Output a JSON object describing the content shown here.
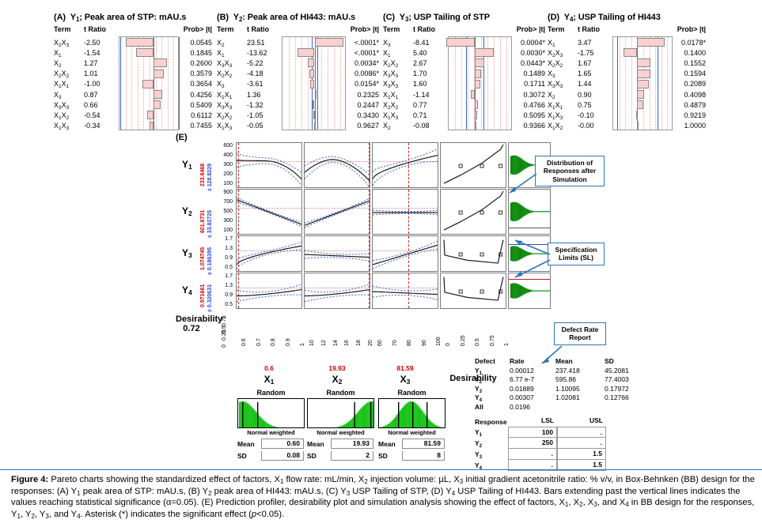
{
  "panels": [
    {
      "id": "A",
      "tag": "(A)",
      "title_prefix": "Y",
      "title_sub": "1",
      "title_rest": "; Peak area of STP: mAU.s",
      "col_term": "Term",
      "col_tratio": "t Ratio",
      "col_prob": "Prob> |t|",
      "rows": [
        {
          "term": "X2X3",
          "t": "-2.50",
          "p": "0.0545"
        },
        {
          "term": "X1",
          "t": "-1.54",
          "p": "0.1845"
        },
        {
          "term": "X2",
          "t": "1.27",
          "p": "0.2600"
        },
        {
          "term": "X2X2",
          "t": "1.01",
          "p": "0.3579"
        },
        {
          "term": "X1X1",
          "t": "-1.00",
          "p": "0.3654"
        },
        {
          "term": "X3",
          "t": "0.87",
          "p": "0.4256"
        },
        {
          "term": "X3X3",
          "t": "0.66",
          "p": "0.5409"
        },
        {
          "term": "X1X2",
          "t": "-0.54",
          "p": "0.6112"
        },
        {
          "term": "X1X3",
          "t": "-0.34",
          "p": "0.7455"
        }
      ]
    },
    {
      "id": "B",
      "tag": "(B)",
      "title_prefix": "Y",
      "title_sub": "2",
      "title_rest": ": Peak area of HI443: mAU.s",
      "col_term": "Term",
      "col_tratio": "t Ratio",
      "col_prob": "Prob> |t|",
      "rows": [
        {
          "term": "X2",
          "t": "23.51",
          "p": "<.0001*"
        },
        {
          "term": "X1",
          "t": "-13.62",
          "p": "<.0001*"
        },
        {
          "term": "X3X3",
          "t": "-5.22",
          "p": "0.0034*"
        },
        {
          "term": "X2X2",
          "t": "-4.18",
          "p": "0.0086*"
        },
        {
          "term": "X3",
          "t": "-3.61",
          "p": "0.0154*"
        },
        {
          "term": "X1X1",
          "t": "1.36",
          "p": "0.2325"
        },
        {
          "term": "X3X3",
          "t": "-1.32",
          "p": "0.2447"
        },
        {
          "term": "X2X2",
          "t": "-1.05",
          "p": "0.3430"
        },
        {
          "term": "X1X3",
          "t": "-0.05",
          "p": "0.9627"
        }
      ]
    },
    {
      "id": "C",
      "tag": "(C)",
      "title_prefix": "Y",
      "title_sub": "3",
      "title_rest": "; USP Tailing of STP",
      "col_term": "Term",
      "col_tratio": "t Ratio",
      "col_prob": "Prob> |t|",
      "rows": [
        {
          "term": "X3",
          "t": "-8.41",
          "p": "0.0004*"
        },
        {
          "term": "X1",
          "t": "5.40",
          "p": "0.0030*"
        },
        {
          "term": "X2X2",
          "t": "2.67",
          "p": "0.0443*"
        },
        {
          "term": "X3X3",
          "t": "1.70",
          "p": "0.1489"
        },
        {
          "term": "X3X3",
          "t": "1.60",
          "p": "0.1711"
        },
        {
          "term": "X1X1",
          "t": "-1.14",
          "p": "0.3072"
        },
        {
          "term": "X2X2",
          "t": "0.77",
          "p": "0.4766"
        },
        {
          "term": "X1X3",
          "t": "0.71",
          "p": "0.5095"
        },
        {
          "term": "X2",
          "t": "-0.08",
          "p": "0.9366"
        }
      ]
    },
    {
      "id": "D",
      "tag": "(D)",
      "title_prefix": "Y",
      "title_sub": "4",
      "title_rest": "; USP Tailing of HI443",
      "col_term": "Term",
      "col_tratio": "t Ratio",
      "col_prob": "Prob> |t|",
      "rows": [
        {
          "term": "X1",
          "t": "3.47",
          "p": "0.0178*"
        },
        {
          "term": "X2X3",
          "t": "-1.75",
          "p": "0.1400"
        },
        {
          "term": "X2X2",
          "t": "1.67",
          "p": "0.1552"
        },
        {
          "term": "X3",
          "t": "1.65",
          "p": "0.1594"
        },
        {
          "term": "X3X3",
          "t": "1.44",
          "p": "0.2089"
        },
        {
          "term": "X2",
          "t": "0.90",
          "p": "0.4098"
        },
        {
          "term": "X1X1",
          "t": "0.75",
          "p": "0.4879"
        },
        {
          "term": "X1X3",
          "t": "-0.10",
          "p": "0.9219"
        },
        {
          "term": "X1X2",
          "t": "-0.00",
          "p": "1.0000"
        }
      ]
    }
  ],
  "profiler": {
    "tag": "(E)",
    "rows": [
      {
        "name": "Y",
        "sub": "1",
        "pred": "233.6468",
        "err": "± 128.8229",
        "yticks": [
          "600",
          "400",
          "300",
          "200",
          "100"
        ]
      },
      {
        "name": "Y",
        "sub": "2",
        "pred": "601.6731",
        "err": "± 33.82725",
        "yticks": [
          "900",
          "700",
          "500",
          "300",
          "100"
        ]
      },
      {
        "name": "Y",
        "sub": "3",
        "pred": "1.074745",
        "err": "± 0.186395",
        "yticks": [
          "1.7",
          "1.3",
          "0.9",
          "0.5"
        ]
      },
      {
        "name": "Y",
        "sub": "4",
        "pred": "0.971661",
        "err": "± 0.320631",
        "yticks": [
          "1.7",
          "1.3",
          "0.9",
          "0.5"
        ]
      }
    ],
    "desirability_label": "Desirability",
    "desirability_value": "0.72",
    "desirability_yticks": [
      "1",
      "0.75",
      "0.5",
      "0.25",
      "0"
    ],
    "columns": [
      {
        "var": "X",
        "sub": "1",
        "setting": "0.6",
        "xticks": [
          "0.6",
          "0.7",
          "0.8",
          "0.9",
          "1"
        ],
        "marker_frac": 0.02
      },
      {
        "var": "X",
        "sub": "2",
        "setting": "19.93",
        "xticks": [
          "10",
          "12",
          "14",
          "16",
          "18",
          "20"
        ],
        "marker_frac": 0.96
      },
      {
        "var": "X",
        "sub": "3",
        "setting": "81.59",
        "xticks": [
          "60",
          "70",
          "80",
          "90",
          "100"
        ],
        "marker_frac": 0.54
      },
      {
        "var": "Desirability",
        "sub": "",
        "setting": "",
        "xticks": [
          "0",
          "0.25",
          "0.5",
          "0.75",
          "1"
        ],
        "marker_frac": 0.98
      }
    ]
  },
  "callouts": [
    {
      "id": "distribution",
      "text": "Distribution of Responses after Simulation"
    },
    {
      "id": "spec-limits",
      "text": "Specification Limits (SL)"
    },
    {
      "id": "defect-rate",
      "text": "Defect Rate Report"
    }
  ],
  "defect_table": {
    "headers": [
      "Defect",
      "Rate",
      "Mean",
      "SD"
    ],
    "rows": [
      {
        "label": "Y1",
        "rate": "0.00012",
        "mean": "237.418",
        "sd": "45.2081"
      },
      {
        "label": "Y2",
        "rate": "6.77 e-7",
        "mean": "595.86",
        "sd": "77.4003"
      },
      {
        "label": "Y3",
        "rate": "0.01889",
        "mean": "1.10095",
        "sd": "0.17972"
      },
      {
        "label": "Y4",
        "rate": "0.00307",
        "mean": "1.02081",
        "sd": "0.12766"
      },
      {
        "label": "All",
        "rate": "0.0196",
        "mean": "",
        "sd": ""
      }
    ]
  },
  "spec_table": {
    "headers": [
      "Response",
      "LSL",
      "USL"
    ],
    "rows": [
      {
        "label": "Y1",
        "lsl": "100",
        "usl": "."
      },
      {
        "label": "Y2",
        "lsl": "250",
        "usl": "."
      },
      {
        "label": "Y3",
        "lsl": ".",
        "usl": "1.5"
      },
      {
        "label": "Y4",
        "lsl": ".",
        "usl": "1.5"
      }
    ]
  },
  "random_boxes": [
    {
      "title": "Random",
      "weight": "Normal weighted",
      "mean_label": "Mean",
      "mean": "0.60",
      "sd_label": "SD",
      "sd": "0.08",
      "shape": "right-skew"
    },
    {
      "title": "Random",
      "weight": "Normal weighted",
      "mean_label": "Mean",
      "mean": "19.93",
      "sd_label": "SD",
      "sd": "2",
      "shape": "left-skew"
    },
    {
      "title": "Random",
      "weight": "Normal weighted",
      "mean_label": "Mean",
      "mean": "81.59",
      "sd_label": "SD",
      "sd": "8",
      "shape": "normal"
    }
  ],
  "caption": {
    "num": "Figure 4:",
    "body": "Pareto charts showing the standardized effect of factors, X1 flow rate: mL/min, X2 injection volume: µL, X3 initial gradient acetonitrile ratio: % v/v, in Box-Behnken (BB) design for the responses: (A) Y1 peak area of STP: mAU.s, (B) Y2 peak area of HI443: mAU.s, (C) Y3 USP Tailing of STP, (D) Y4 USP Tailing of HI443. Bars extending past the vertical lines indicates the values reaching statistical significance (α=0.05). (E) Prediction profiler, desirability plot and simulation analysis showing the effect of factors, X1, X2, X3, and X4 in BB design for the responses, Y1, Y2, Y3, and Y4. Asterisk (*) indicates the significant effect (p<0.05)."
  },
  "colors": {
    "bar_fill": "#f9cfcf",
    "bar_stroke": "#8a8a8a",
    "blue_line": "#3a63d8",
    "red_dash": "#dd2222",
    "hist_green": "#0b8a0b",
    "callout_border": "#2e75b6",
    "pred_red": "#cc0000",
    "err_blue": "#2c49c9"
  },
  "chart_data": [
    {
      "type": "bar",
      "title": "(A) Y1; Peak area of STP: mAU.s",
      "orientation": "horizontal",
      "categories": [
        "X2X3",
        "X1",
        "X2",
        "X2X2",
        "X1X1",
        "X3",
        "X3X3",
        "X1X2",
        "X1X3"
      ],
      "values": [
        -2.5,
        -1.54,
        1.27,
        1.01,
        -1.0,
        0.87,
        0.66,
        -0.54,
        -0.34
      ],
      "p_values": [
        "0.0545",
        "0.1845",
        "0.2600",
        "0.3579",
        "0.3654",
        "0.4256",
        "0.5409",
        "0.6112",
        "0.7455"
      ],
      "xlabel": "t Ratio",
      "ylabel": "Term",
      "grid": true,
      "reference_lines": [
        -2.57,
        2.57
      ]
    },
    {
      "type": "bar",
      "title": "(B) Y2: Peak area of HI443: mAU.s",
      "orientation": "horizontal",
      "categories": [
        "X2",
        "X1",
        "X3X3",
        "X2X2",
        "X3",
        "X1X1",
        "X3X3",
        "X2X2",
        "X1X3"
      ],
      "values": [
        23.51,
        -13.62,
        -5.22,
        -4.18,
        -3.61,
        1.36,
        -1.32,
        -1.05,
        -0.05
      ],
      "p_values": [
        "<.0001*",
        "<.0001*",
        "0.0034*",
        "0.0086*",
        "0.0154*",
        "0.2325",
        "0.2447",
        "0.3430",
        "0.9627"
      ],
      "xlabel": "t Ratio",
      "ylabel": "Term",
      "grid": true,
      "reference_lines": [
        -2.57,
        2.57
      ]
    },
    {
      "type": "bar",
      "title": "(C) Y3; USP Tailing of STP",
      "orientation": "horizontal",
      "categories": [
        "X3",
        "X1",
        "X2X2",
        "X3X3",
        "X3X3",
        "X1X1",
        "X2X2",
        "X1X3",
        "X2"
      ],
      "values": [
        -8.41,
        5.4,
        2.67,
        1.7,
        1.6,
        -1.14,
        0.77,
        0.71,
        -0.08
      ],
      "p_values": [
        "0.0004*",
        "0.0030*",
        "0.0443*",
        "0.1489",
        "0.1711",
        "0.3072",
        "0.4766",
        "0.5095",
        "0.9366"
      ],
      "xlabel": "t Ratio",
      "ylabel": "Term",
      "grid": true,
      "reference_lines": [
        -2.57,
        2.57
      ]
    },
    {
      "type": "bar",
      "title": "(D) Y4; USP Tailing of HI443",
      "orientation": "horizontal",
      "categories": [
        "X1",
        "X2X3",
        "X2X2",
        "X3",
        "X3X3",
        "X2",
        "X1X1",
        "X1X3",
        "X1X2"
      ],
      "values": [
        3.47,
        -1.75,
        1.67,
        1.65,
        1.44,
        0.9,
        0.75,
        -0.1,
        -0.0
      ],
      "p_values": [
        "0.0178*",
        "0.1400",
        "0.1552",
        "0.1594",
        "0.2089",
        "0.4098",
        "0.4879",
        "0.9219",
        "1.0000"
      ],
      "xlabel": "t Ratio",
      "ylabel": "Term",
      "grid": true,
      "reference_lines": [
        -2.57,
        2.57
      ]
    },
    {
      "type": "line",
      "title": "(E) Prediction profiler",
      "subtitle": "Desirability plot and simulation analysis",
      "responses": [
        "Y1",
        "Y2",
        "Y3",
        "Y4",
        "Desirability"
      ],
      "factors": [
        "X1",
        "X2",
        "X3",
        "Desirability"
      ],
      "current_settings": {
        "X1": 0.6,
        "X2": 19.93,
        "X3": 81.59
      },
      "predicted": {
        "Y1": 233.6468,
        "Y2": 601.6731,
        "Y3": 1.074745,
        "Y4": 0.971661,
        "Desirability": 0.72
      },
      "prediction_error": {
        "Y1": 128.8229,
        "Y2": 33.82725,
        "Y3": 0.186395,
        "Y4": 0.320631
      },
      "ylim": {
        "Y1": [
          100,
          600
        ],
        "Y2": [
          100,
          900
        ],
        "Y3": [
          0.5,
          1.7
        ],
        "Y4": [
          0.5,
          1.7
        ],
        "Desirability": [
          0,
          1
        ]
      },
      "xlim": {
        "X1": [
          0.6,
          1
        ],
        "X2": [
          10,
          20
        ],
        "X3": [
          60,
          100
        ],
        "Desirability": [
          0,
          1
        ]
      },
      "grid": true,
      "legend": "none"
    }
  ]
}
